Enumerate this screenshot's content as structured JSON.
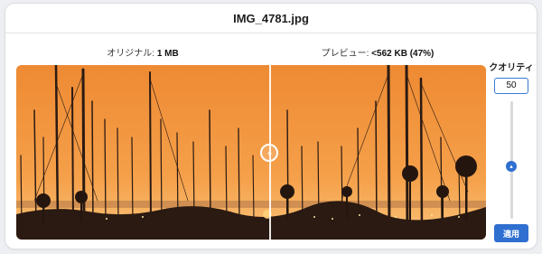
{
  "window": {
    "title": "IMG_4781.jpg"
  },
  "labels": {
    "original_prefix": "オリジナル: ",
    "original_size": "1 MB",
    "preview_prefix": "プレビュー: ",
    "preview_size": "<562 KB (47%)"
  },
  "quality": {
    "label": "クオリティ",
    "value": "50",
    "level_fraction": 0.5,
    "apply_label": "適用"
  },
  "compare": {
    "handle_icon": "left-right-arrows-icon",
    "divider_fraction": 0.54
  },
  "colors": {
    "accent": "#2f6fd0",
    "sky_top": "#f08a2c",
    "sky_bottom": "#f8c06a"
  }
}
